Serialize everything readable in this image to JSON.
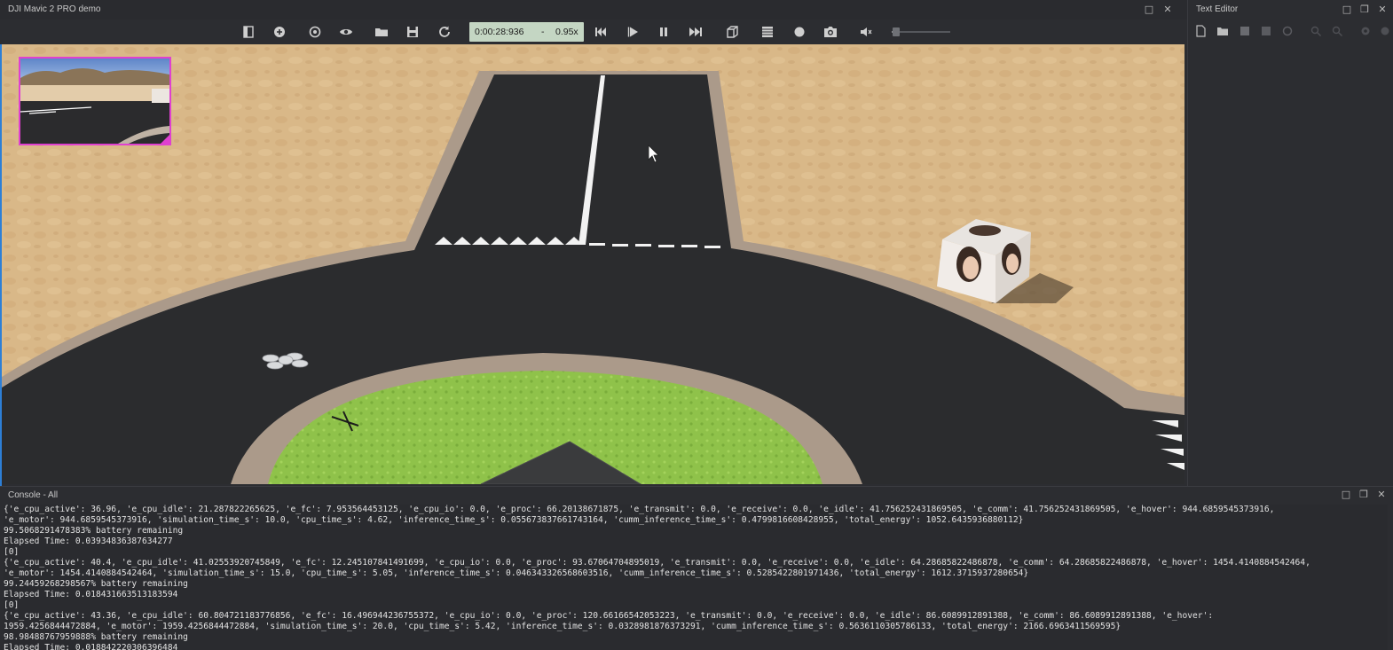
{
  "sim_window": {
    "title": "DJI Mavic 2 PRO demo",
    "buttons": [
      "maximize-icon",
      "close-icon"
    ]
  },
  "toolbar": {
    "time": "0:00:28:936",
    "separator": "-",
    "speed": "0.95x",
    "volume_level": 0.05,
    "icons": [
      "scene-tree-icon",
      "add-node-icon",
      "reset-view-icon",
      "visibility-icon",
      "open-world-icon",
      "save-world-icon",
      "reload-world-icon",
      "step-back-icon",
      "play-icon",
      "pause-icon",
      "fast-forward-icon",
      "view-3d-icon",
      "movie-record-icon",
      "record-icon",
      "screenshot-icon",
      "volume-icon"
    ]
  },
  "editor": {
    "title": "Text Editor",
    "icons": [
      "new-file-icon",
      "open-file-icon",
      "save-file-icon",
      "save-as-icon",
      "revert-icon",
      "find-icon",
      "replace-icon",
      "settings-icon",
      "close-file-icon"
    ]
  },
  "console": {
    "title": "Console - All",
    "lines": [
      "{'e_cpu_active': 36.96, 'e_cpu_idle': 21.287822265625, 'e_fc': 7.953564453125, 'e_cpu_io': 0.0, 'e_proc': 66.20138671875, 'e_transmit': 0.0, 'e_receive': 0.0, 'e_idle': 41.756252431869505, 'e_comm': 41.756252431869505, 'e_hover': 944.6859545373916,",
      "'e_motor': 944.6859545373916, 'simulation_time_s': 10.0, 'cpu_time_s': 4.62, 'inference_time_s': 0.055673837661743164, 'cumm_inference_time_s': 0.4799816608428955, 'total_energy': 1052.6435936880112}",
      "99.5068291478383% battery remaining",
      "Elapsed Time: 0.03934836387634277",
      "[0]",
      "{'e_cpu_active': 40.4, 'e_cpu_idle': 41.02553920745849, 'e_fc': 12.245107841491699, 'e_cpu_io': 0.0, 'e_proc': 93.67064704895019, 'e_transmit': 0.0, 'e_receive': 0.0, 'e_idle': 64.28685822486878, 'e_comm': 64.28685822486878, 'e_hover': 1454.4140884542464,",
      "'e_motor': 1454.4140884542464, 'simulation_time_s': 15.0, 'cpu_time_s': 5.05, 'inference_time_s': 0.046343326568603516, 'cumm_inference_time_s': 0.5285422801971436, 'total_energy': 1612.3715937280654}",
      "99.24459268298567% battery remaining",
      "Elapsed Time: 0.018431663513183594",
      "[0]",
      "{'e_cpu_active': 43.36, 'e_cpu_idle': 60.804721183776856, 'e_fc': 16.496944236755372, 'e_cpu_io': 0.0, 'e_proc': 120.66166542053223, 'e_transmit': 0.0, 'e_receive': 0.0, 'e_idle': 86.6089912891388, 'e_comm': 86.6089912891388, 'e_hover':",
      "1959.4256844472884, 'e_motor': 1959.4256844472884, 'simulation_time_s': 20.0, 'cpu_time_s': 5.42, 'inference_time_s': 0.0328981876373291, 'cumm_inference_time_s': 0.5636110305786133, 'total_energy': 2166.6963411569595}",
      "98.98488767959888% battery remaining",
      "Elapsed Time: 0.018842220306396484"
    ]
  },
  "colors": {
    "sand": "#d9b888",
    "asphalt": "#2b2c2e",
    "curb": "#ab9a8a",
    "grass": "#8fc24a",
    "time_box": "#c4d6c3",
    "minimap_border": "#e040d0"
  }
}
